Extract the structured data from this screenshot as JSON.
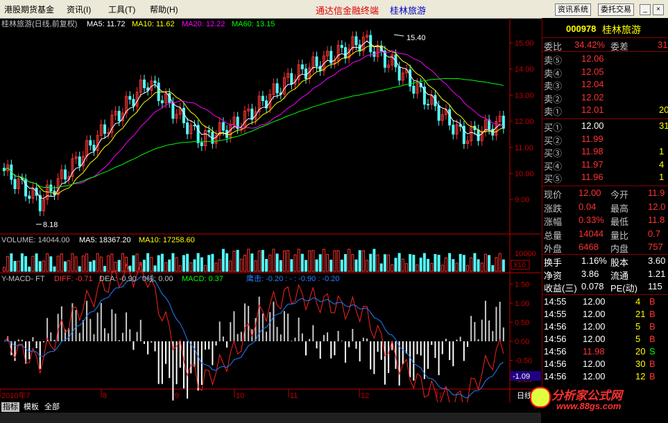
{
  "menu": {
    "brand": "港股期货基金",
    "items": [
      "资讯(I)",
      "工具(T)",
      "帮助(H)"
    ],
    "app_title": "通达信金融终端",
    "stock_title": "桂林旅游",
    "btn_news": "资讯系统",
    "btn_order": "委托交易"
  },
  "colors": {
    "up": "#ff3232",
    "down": "#54fcfc",
    "ma5": "#ffffff",
    "ma10": "#ffff00",
    "ma20": "#ff00ff",
    "ma60": "#00ff00",
    "axis": "#c00000",
    "blue": "#2080ff"
  },
  "price_panel": {
    "title": "桂林旅游(日线,前复权)",
    "ma5_label": "MA5: 11.72",
    "ma10_label": "MA10: 11.62",
    "ma20_label": "MA20: 12.22",
    "ma60_label": "MA60: 13.15",
    "high_label": "15.40",
    "low_label": "8.18",
    "ticks": [
      "15.00",
      "14.00",
      "13.00",
      "12.00",
      "11.00",
      "10.00",
      "9.00"
    ]
  },
  "volume_panel": {
    "vol_label": "VOLUME: 14044.00",
    "ma5_label": "MA5: 18367.20",
    "ma10_label": "MA10: 17258.60",
    "tick": "10000",
    "unit": "X10"
  },
  "macd_panel": {
    "name": "Y-MACD- FT",
    "diff": "DIFF: -0.71",
    "dea": "DEA: -0.90",
    "zero": "0线: 0.00",
    "macd": "MACD: 0.37",
    "attack": "鹰击: -0.20 : - : -0.90 : -0.20",
    "ticks": [
      "1.50",
      "1.00",
      "0.50",
      "0.00",
      "-0.50",
      "-1.00"
    ],
    "cursor_value": "-1.09"
  },
  "x_axis": {
    "labels": [
      "2010年7",
      "8",
      "9",
      "10",
      "11",
      "12",
      "1"
    ],
    "period": "日线"
  },
  "quote": {
    "code": "000978",
    "name": "桂林旅游",
    "wei_bi_label": "委比",
    "wei_bi": "34.42%",
    "wei_cha_label": "委差",
    "wei_cha": "31",
    "sells": [
      {
        "label": "卖⑤",
        "price": "12.06",
        "vol": ""
      },
      {
        "label": "卖④",
        "price": "12.05",
        "vol": ""
      },
      {
        "label": "卖③",
        "price": "12.04",
        "vol": ""
      },
      {
        "label": "卖②",
        "price": "12.02",
        "vol": ""
      },
      {
        "label": "卖①",
        "price": "12.01",
        "vol": "20"
      }
    ],
    "buys": [
      {
        "label": "买①",
        "price": "12.00",
        "vol": "31"
      },
      {
        "label": "买②",
        "price": "11.99",
        "vol": ""
      },
      {
        "label": "买③",
        "price": "11.98",
        "vol": "1"
      },
      {
        "label": "买④",
        "price": "11.97",
        "vol": "4"
      },
      {
        "label": "买⑤",
        "price": "11.96",
        "vol": "1"
      }
    ],
    "stats": [
      {
        "l1": "现价",
        "v1": "12.00",
        "l2": "今开",
        "v2": "11.9"
      },
      {
        "l1": "涨跌",
        "v1": "0.04",
        "l2": "最高",
        "v2": "12.0"
      },
      {
        "l1": "涨幅",
        "v1": "0.33%",
        "l2": "最低",
        "v2": "11.8"
      },
      {
        "l1": "总量",
        "v1": "14044",
        "l2": "量比",
        "v2": "0.7"
      },
      {
        "l1": "外盘",
        "v1": "6468",
        "l2": "内盘",
        "v2": "757"
      }
    ],
    "stats2": [
      {
        "l1": "换手",
        "v1": "1.16%",
        "l2": "股本",
        "v2": "3.60"
      },
      {
        "l1": "净资",
        "v1": "3.86",
        "l2": "流通",
        "v2": "1.21"
      },
      {
        "l1": "收益(三)",
        "v1": "0.078",
        "l2": "PE(动)",
        "v2": "115"
      }
    ],
    "ticks": [
      {
        "time": "14:55",
        "price": "12.00",
        "vol": "4",
        "side": "B"
      },
      {
        "time": "14:55",
        "price": "12.00",
        "vol": "21",
        "side": "B"
      },
      {
        "time": "14:56",
        "price": "12.00",
        "vol": "5",
        "side": "B"
      },
      {
        "time": "14:56",
        "price": "12.00",
        "vol": "5",
        "side": "B"
      },
      {
        "time": "14:56",
        "price": "11.98",
        "vol": "20",
        "side": "S"
      },
      {
        "time": "14:56",
        "price": "12.00",
        "vol": "30",
        "side": "B"
      },
      {
        "time": "14:56",
        "price": "12.00",
        "vol": "12",
        "side": "B"
      }
    ]
  },
  "bottom_tabs": [
    "指标",
    "模板",
    "全部"
  ],
  "watermark": {
    "brand": "分析家公式网",
    "url": "www.88gs.com"
  }
}
